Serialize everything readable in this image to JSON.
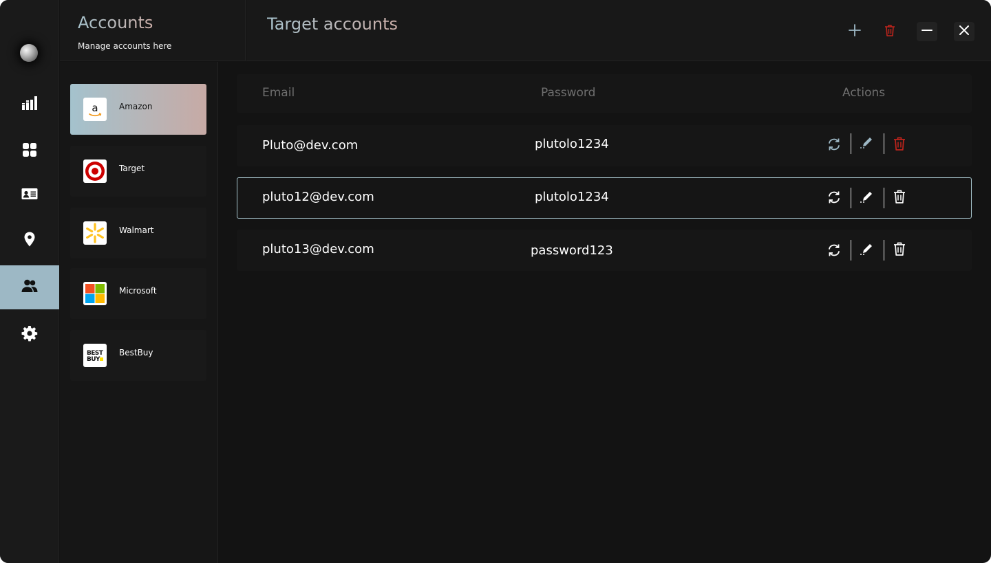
{
  "colors": {
    "accent": "#9db8c5",
    "accent_gradient_end": "#cdb0aa",
    "danger": "#c0241c",
    "background": "#131313"
  },
  "rail": {
    "items": [
      {
        "name": "stats",
        "icon": "bar-chart-icon"
      },
      {
        "name": "dashboard",
        "icon": "grid-icon"
      },
      {
        "name": "profiles",
        "icon": "id-card-icon"
      },
      {
        "name": "locations",
        "icon": "map-pin-icon"
      },
      {
        "name": "accounts",
        "icon": "users-icon",
        "active": true
      },
      {
        "name": "settings",
        "icon": "gear-icon"
      }
    ]
  },
  "accounts_panel": {
    "title": "Accounts",
    "subtitle": "Manage accounts here"
  },
  "header": {
    "title": "Target accounts",
    "buttons": [
      "plus-icon",
      "trash-icon",
      "minimize-icon",
      "close-icon"
    ]
  },
  "stores": [
    {
      "name": "Amazon",
      "logo": "amazon-logo",
      "active": true
    },
    {
      "name": "Target",
      "logo": "target-logo"
    },
    {
      "name": "Walmart",
      "logo": "walmart-logo"
    },
    {
      "name": "Microsoft",
      "logo": "microsoft-logo"
    },
    {
      "name": "BestBuy",
      "logo": "bestbuy-logo",
      "logo_text": "BEST BUY"
    }
  ],
  "table": {
    "columns": [
      "Email",
      "Password",
      "Actions"
    ],
    "rows": [
      {
        "email": "Pluto@dev.com",
        "password": "plutolo1234",
        "actions_highlighted": true
      },
      {
        "email": "pluto12@dev.com",
        "password": "plutolo1234",
        "selected": true
      },
      {
        "email": "pluto13@dev.com",
        "password": "password123"
      }
    ],
    "actions": [
      "refresh-icon",
      "edit-icon",
      "delete-icon"
    ]
  }
}
